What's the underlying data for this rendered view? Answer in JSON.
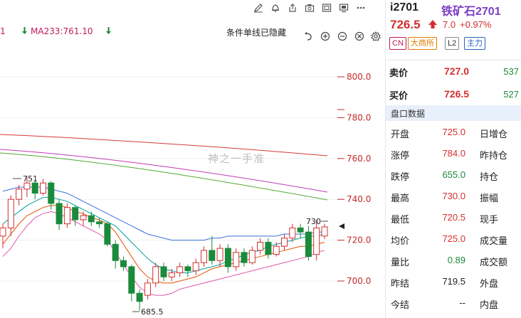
{
  "indicators": {
    "ma233_label": "MA233:761.10",
    "right_text": "条件单线已隐藏",
    "left_fragment": "1"
  },
  "chart": {
    "y_axis_ticks": [
      "800.0",
      "780.0",
      "760.0",
      "740.0",
      "720.0",
      "700.0"
    ],
    "high_annotation": "751",
    "low_annotation": "685.5",
    "recent_high_annotation": "730",
    "watermark": "神之一手准"
  },
  "chart_data": {
    "type": "candlestick",
    "y_ticks": [
      700,
      720,
      740,
      760,
      780,
      800
    ],
    "ylim": [
      684,
      808
    ],
    "current_price": 726.5,
    "candles": [
      {
        "o": 722,
        "c": 726,
        "h": 728,
        "l": 716
      },
      {
        "o": 726,
        "c": 740,
        "h": 742,
        "l": 722
      },
      {
        "o": 740,
        "c": 745,
        "h": 747,
        "l": 737
      },
      {
        "o": 745,
        "c": 748,
        "h": 751,
        "l": 741
      },
      {
        "o": 748,
        "c": 743,
        "h": 749,
        "l": 740
      },
      {
        "o": 743,
        "c": 748,
        "h": 750,
        "l": 742
      },
      {
        "o": 748,
        "c": 738,
        "h": 749,
        "l": 735
      },
      {
        "o": 738,
        "c": 728,
        "h": 740,
        "l": 725
      },
      {
        "o": 728,
        "c": 736,
        "h": 738,
        "l": 726
      },
      {
        "o": 736,
        "c": 730,
        "h": 737,
        "l": 727
      },
      {
        "o": 730,
        "c": 732,
        "h": 734,
        "l": 727
      },
      {
        "o": 732,
        "c": 729,
        "h": 734,
        "l": 727
      },
      {
        "o": 729,
        "c": 728,
        "h": 731,
        "l": 726
      },
      {
        "o": 728,
        "c": 718,
        "h": 729,
        "l": 717
      },
      {
        "o": 718,
        "c": 710,
        "h": 720,
        "l": 706
      },
      {
        "o": 710,
        "c": 707,
        "h": 712,
        "l": 705
      },
      {
        "o": 707,
        "c": 694,
        "h": 708,
        "l": 690
      },
      {
        "o": 694,
        "c": 690,
        "h": 696,
        "l": 685.5
      },
      {
        "o": 693,
        "c": 699,
        "h": 701,
        "l": 691
      },
      {
        "o": 699,
        "c": 707,
        "h": 709,
        "l": 697
      },
      {
        "o": 707,
        "c": 702,
        "h": 709,
        "l": 700
      },
      {
        "o": 702,
        "c": 704,
        "h": 706,
        "l": 700
      },
      {
        "o": 704,
        "c": 707,
        "h": 709,
        "l": 702
      },
      {
        "o": 707,
        "c": 705,
        "h": 708,
        "l": 702
      },
      {
        "o": 705,
        "c": 709,
        "h": 711,
        "l": 703
      },
      {
        "o": 709,
        "c": 715,
        "h": 717,
        "l": 707
      },
      {
        "o": 715,
        "c": 710,
        "h": 722,
        "l": 708
      },
      {
        "o": 710,
        "c": 716,
        "h": 718,
        "l": 707
      },
      {
        "o": 716,
        "c": 707,
        "h": 718,
        "l": 704
      },
      {
        "o": 707,
        "c": 714,
        "h": 716,
        "l": 705
      },
      {
        "o": 714,
        "c": 709,
        "h": 716,
        "l": 707
      },
      {
        "o": 709,
        "c": 715,
        "h": 717,
        "l": 708
      },
      {
        "o": 715,
        "c": 719,
        "h": 721,
        "l": 713
      },
      {
        "o": 719,
        "c": 713,
        "h": 721,
        "l": 711
      },
      {
        "o": 713,
        "c": 717,
        "h": 719,
        "l": 712
      },
      {
        "o": 717,
        "c": 721,
        "h": 723,
        "l": 715
      },
      {
        "o": 721,
        "c": 726,
        "h": 728,
        "l": 719
      },
      {
        "o": 726,
        "c": 724,
        "h": 728,
        "l": 721
      },
      {
        "o": 724,
        "c": 712,
        "h": 727,
        "l": 710
      },
      {
        "o": 713,
        "c": 726,
        "h": 730,
        "l": 710
      },
      {
        "o": 722,
        "c": 726.5,
        "h": 728,
        "l": 720.5
      }
    ],
    "ma_series": [
      {
        "color": "#e65100",
        "values": [
          718,
          723,
          728,
          732,
          734,
          736,
          737,
          737,
          736,
          734,
          733,
          731,
          730,
          728,
          724,
          718,
          712,
          706,
          702,
          700,
          699,
          699,
          700,
          701,
          702,
          704,
          706,
          707,
          708,
          709,
          710,
          711,
          712,
          713,
          714,
          715,
          716,
          717,
          717,
          718,
          719
        ]
      },
      {
        "color": "#00a0a0",
        "values": [
          728,
          731,
          734,
          737,
          739,
          741,
          741,
          740,
          739,
          737,
          735,
          733,
          731,
          729,
          727,
          723,
          719,
          715,
          711,
          708,
          706,
          705,
          704,
          704,
          705,
          706,
          707,
          708,
          710,
          711,
          713,
          714,
          715,
          717,
          718,
          719,
          720,
          721,
          722,
          722,
          723
        ]
      },
      {
        "color": "#3f6fd8",
        "values": [
          744,
          745,
          746,
          746,
          746,
          746,
          745,
          744,
          743,
          741,
          739,
          737,
          735,
          733,
          731,
          729,
          727,
          725,
          723,
          722,
          721,
          720,
          720,
          720,
          720,
          720,
          721,
          721,
          722,
          722,
          722,
          722,
          722,
          722,
          722,
          723,
          723,
          723,
          723,
          724,
          724
        ]
      }
    ]
  },
  "quote": {
    "code": "i2701",
    "name": "铁矿石2701",
    "last_price": "726.5",
    "change": "7.0",
    "change_pct": "+0.97%",
    "tags": [
      "CN",
      "大商所",
      "L2",
      "主力"
    ],
    "ask_label": "卖价",
    "ask_price": "727.0",
    "ask_vol": "537",
    "bid_label": "买价",
    "bid_price": "726.5",
    "bid_vol": "527",
    "section_title": "盘口数据",
    "rows": [
      {
        "label": "开盘",
        "value": "725.0",
        "value_color": "#d32f2f",
        "right": "日增仓"
      },
      {
        "label": "涨停",
        "value": "784.0",
        "value_color": "#d32f2f",
        "right": "昨持仓"
      },
      {
        "label": "跌停",
        "value": "655.0",
        "value_color": "#1a8b3a",
        "right": "持仓"
      },
      {
        "label": "最高",
        "value": "730.0",
        "value_color": "#d32f2f",
        "right": "振幅"
      },
      {
        "label": "最低",
        "value": "720.5",
        "value_color": "#d32f2f",
        "right": "现手"
      },
      {
        "label": "均价",
        "value": "725.0",
        "value_color": "#d32f2f",
        "right": "成交量"
      },
      {
        "label": "量比",
        "value": "0.89",
        "value_color": "#1a8b3a",
        "right": "成交额"
      },
      {
        "label": "昨结",
        "value": "719.5",
        "value_color": "#222222",
        "right": "外盘"
      },
      {
        "label": "今结",
        "value": "--",
        "value_color": "#222222",
        "right": "内盘"
      }
    ]
  },
  "colors": {
    "up": "#d32f2f",
    "down": "#1a8b3a",
    "accent_purple": "#7b3fc4"
  },
  "icons": [
    "edit-icon",
    "bell-icon",
    "share-icon",
    "camera-icon",
    "image-icon",
    "display-icon",
    "menu-icon",
    "undo-icon",
    "zoom-in-icon",
    "zoom-out-icon",
    "settings-icon",
    "up-arrow-icon",
    "down-arrow-icon"
  ]
}
